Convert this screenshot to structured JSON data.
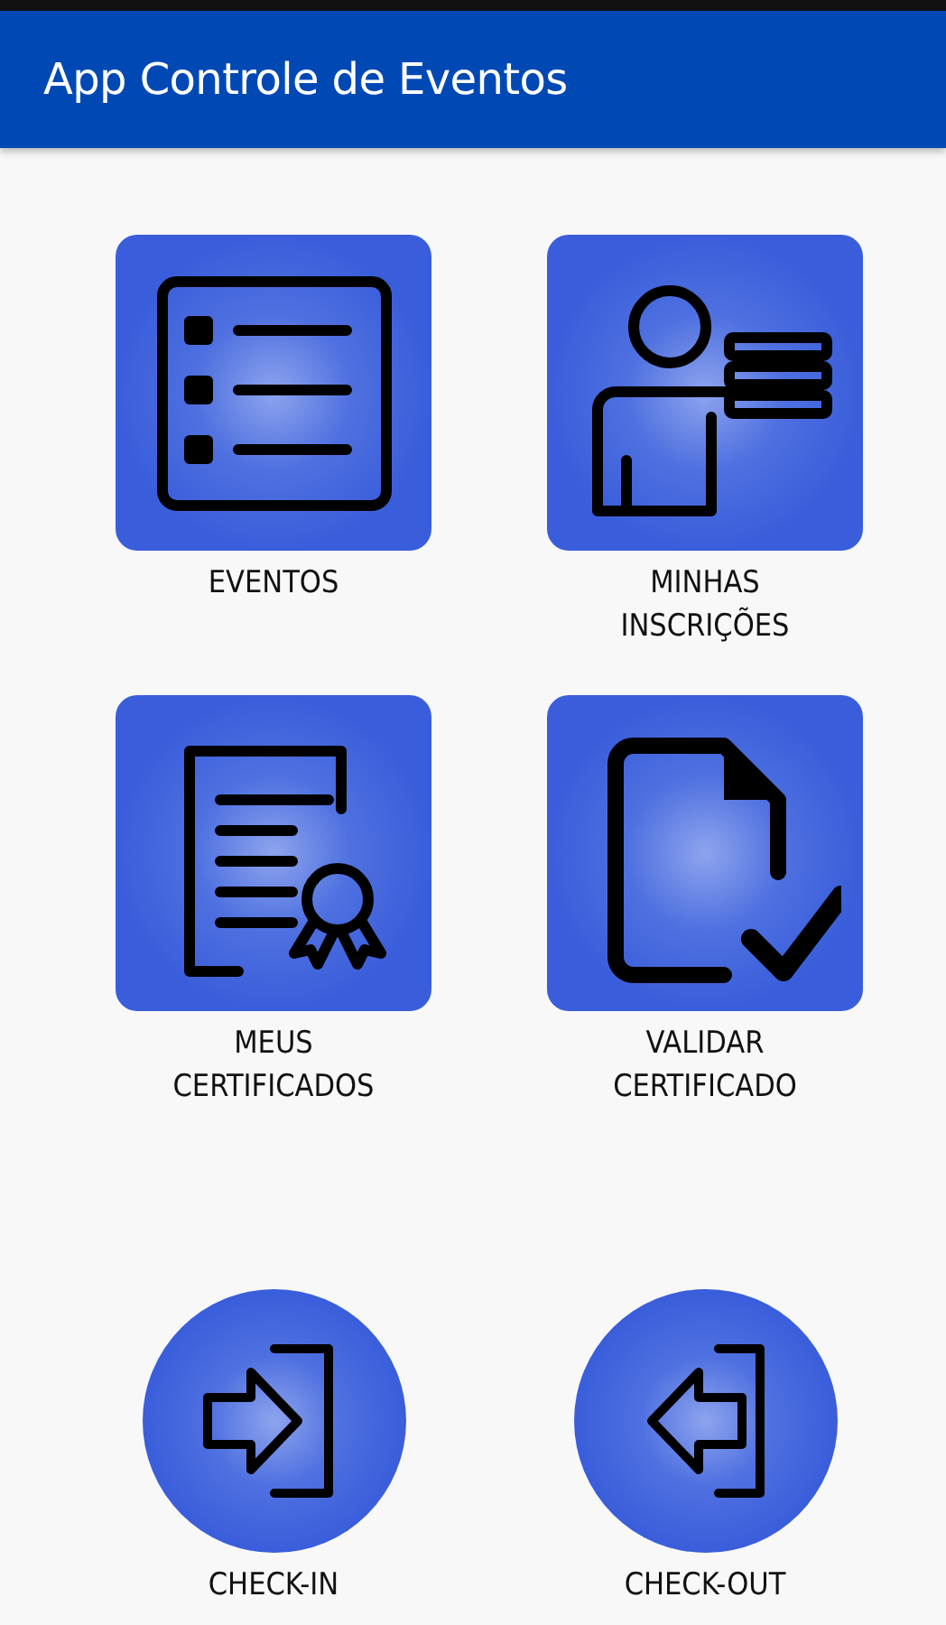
{
  "app_bar": {
    "title": "App Controle de Eventos"
  },
  "menu": [
    {
      "kind": "square",
      "label": "EVENTOS"
    },
    {
      "kind": "square",
      "label": "MINHAS\nINSCRIÇÕES"
    },
    {
      "kind": "square",
      "label": "MEUS\nCERTIFICADOS"
    },
    {
      "kind": "square",
      "label": "VALIDAR\nCERTIFICADO"
    },
    {
      "kind": "round",
      "label": "CHECK-IN"
    },
    {
      "kind": "round",
      "label": "CHECK-OUT"
    }
  ]
}
